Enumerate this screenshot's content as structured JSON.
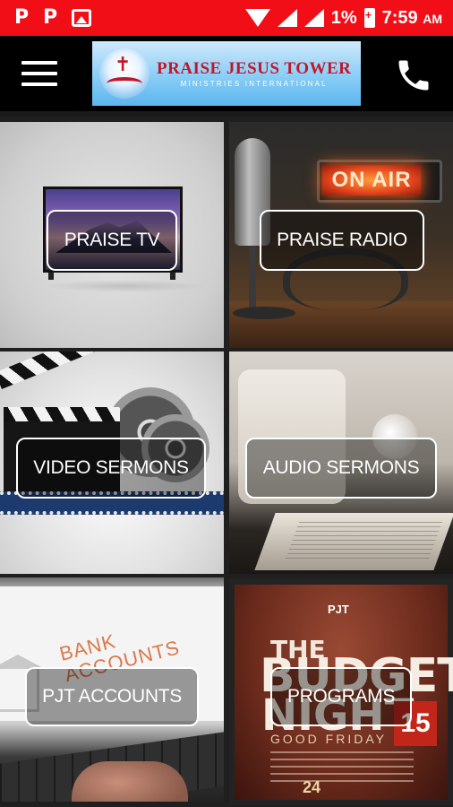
{
  "status_bar": {
    "time": "7:59",
    "ampm": "AM",
    "battery": "1%"
  },
  "app_bar": {
    "logo_title": "PRAISE JESUS TOWER",
    "logo_subtitle": "MINISTRIES INTERNATIONAL",
    "menu_icon": "hamburger-menu-icon",
    "call_icon": "phone-icon"
  },
  "tiles": [
    {
      "label": "PRAISE TV"
    },
    {
      "label": "PRAISE RADIO"
    },
    {
      "label": "VIDEO SERMONS"
    },
    {
      "label": "AUDIO SERMONS"
    },
    {
      "label": "PJT ACCOUNTS"
    },
    {
      "label": "PROGRAMS"
    }
  ],
  "artwork": {
    "on_air": "ON AIR",
    "bank_line1": "BANK",
    "bank_line2": "ACCOUNTS",
    "poster_logo": "PJT",
    "poster_the": "THE",
    "poster_budget": "BUDGET",
    "poster_night": "NIGHT",
    "poster_date": "15",
    "poster_good_friday": "GOOD FRIDAY",
    "poster_24": "24"
  },
  "colors": {
    "status_bar": "#f20e16",
    "app_bar": "#000000",
    "logo_title": "#c0182b"
  }
}
